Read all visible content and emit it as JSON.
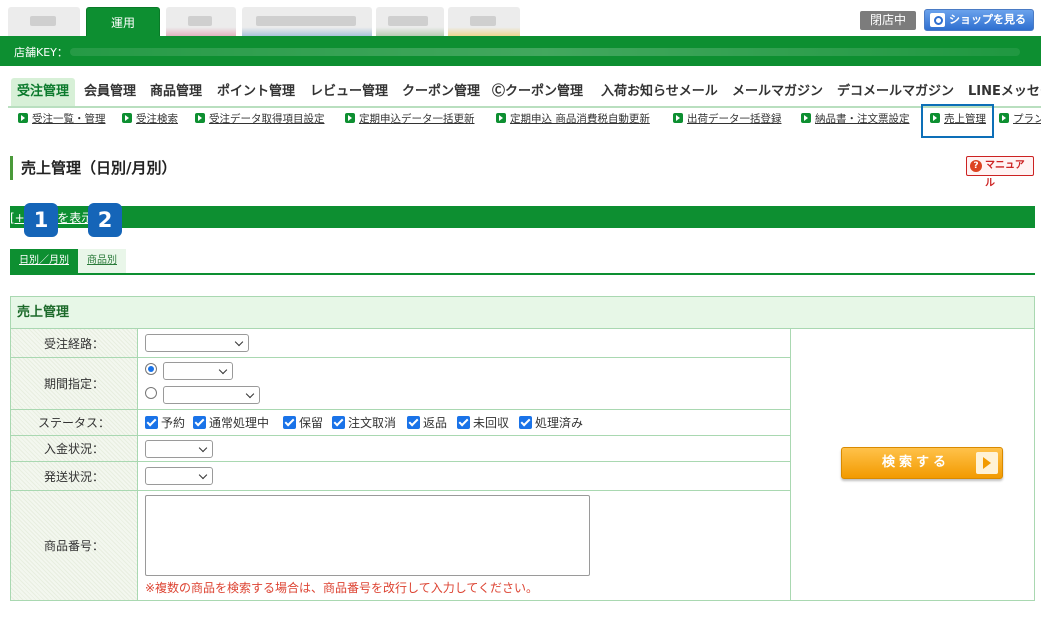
{
  "top_tabs": {
    "active_label": "運用"
  },
  "header": {
    "status_badge": "閉店中",
    "shop_button": "ショップを見る",
    "store_key_label": "店舗KEY："
  },
  "main_menu": [
    "受注管理",
    "会員管理",
    "商品管理",
    "ポイント管理",
    "レビュー管理",
    "クーポン管理",
    "Ⓒクーポン管理",
    "入荷お知らせメール",
    "メールマガジン",
    "デコメールマガジン",
    "LINEメッセー"
  ],
  "sub_menu": [
    "受注一覧・管理",
    "受注検索",
    "受注データ取得項目設定",
    "定期申込データ一括更新",
    "定期申込 商品消費税自動更新",
    "出荷データ一括登録",
    "納品書・注文票設定",
    "売上管理",
    "プラン"
  ],
  "page": {
    "title": "売上管理（日別/月別）",
    "manual_button": "マニュアル",
    "explain_text": "[+] 説明を表示",
    "badges": [
      "1",
      "2"
    ]
  },
  "view_tabs": {
    "daily_monthly": "日別／月別",
    "by_product": "商品別"
  },
  "form": {
    "heading": "売上管理",
    "route_label": "受注経路：",
    "period_label": "期間指定：",
    "status_label": "ステータス：",
    "status_options": [
      "予約",
      "通常処理中",
      "保留",
      "注文取消",
      "返品",
      "未回収",
      "処理済み"
    ],
    "payment_label": "入金状況：",
    "shipping_label": "発送状況：",
    "product_label": "商品番号：",
    "product_note": "※複数の商品を検索する場合は、商品番号を改行して入力してください。",
    "search_button": "検索する"
  }
}
